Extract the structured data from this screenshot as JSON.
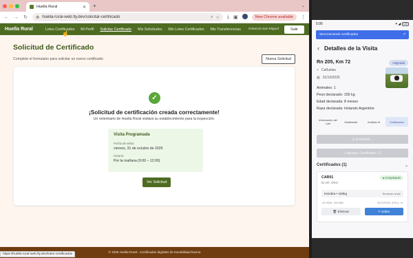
{
  "browser": {
    "tab_title": "Huella Rural",
    "url": "huella-rural-web.fly.dev/solicitar-certificado",
    "update_label": "New Chrome available",
    "status_url": "https://huella-rural-web.fly.dev/lotes-certificados"
  },
  "app": {
    "brand": "Huella Rural",
    "nav": [
      {
        "label": "Lotes Certificados"
      },
      {
        "label": "Mi Perfil"
      },
      {
        "label": "Solicitar Certificado"
      },
      {
        "label": "Mis Solicitudes"
      },
      {
        "label": "Mis Lotes Certificados"
      },
      {
        "label": "Mis Transferencias"
      }
    ],
    "establishment": "Estancia San Miguel",
    "logout_label": "Salir",
    "page_title": "Solicitud de Certificado",
    "page_subtitle": "Complete el formulario para solicitar un nuevo certificado",
    "new_request_label": "Nueva Solicitud",
    "success": {
      "title": "¡Solicitud de certificación creada correctamente!",
      "description": "Un veterinario de Huella Rural visitará su establecimiento para la inspección.",
      "visit_title": "Visita Programada",
      "date_label": "Fecha de visita:",
      "date_value": "viernes, 31 de octubre de 2025",
      "time_label": "Horario:",
      "time_value": "Por la mañana (9:00 – 12:00)",
      "view_button": "Ver Solicitud"
    },
    "footer": "© 2025 Huella Rural - Certificados digitales de trazabilidad bovina"
  },
  "phone": {
    "time": "5:06",
    "battery": "100",
    "sync_banner": "Sincronizando certificados",
    "title": "Detalles de la Visita",
    "address": "Rn 205, Km 72",
    "status_badge": "Asignada",
    "location": "Cañuelas",
    "date": "31/10/2025",
    "facts": [
      "Animales: 1",
      "Peso declarado: 155 kg",
      "Edad declarada: 8 meses",
      "Raza declarada: Holando Argentino"
    ],
    "tabs": [
      {
        "label": "Información del Lote"
      },
      {
        "label": "Multimedia"
      },
      {
        "label": "Análisis IA"
      },
      {
        "label": "Certificados"
      }
    ],
    "sending_label": "Enviando...",
    "add_cert_label": "Agregar Certificado 1/1",
    "certs_title": "Certificados (1)",
    "cert": {
      "id": "CAR01",
      "sub": "ID AR: AR01",
      "badge": "Completado",
      "desc": "Hembra • 150kg",
      "temp": "Ternera/o al pie",
      "coords": "-34.9336, -58.4350",
      "datetime": "30/10/2025, 5:05 p. m."
    },
    "delete_label": "Eliminar",
    "edit_label": "Editar"
  }
}
